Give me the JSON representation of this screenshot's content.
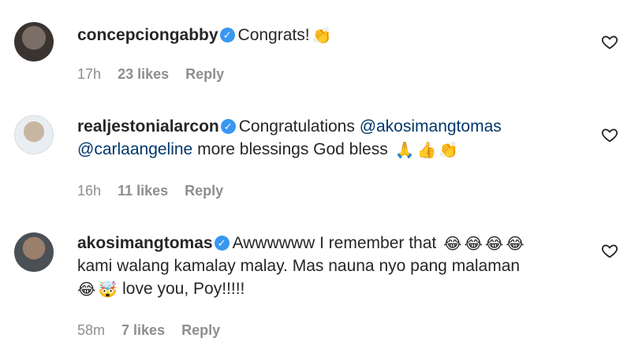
{
  "comments": [
    {
      "username": "concepciongabby",
      "text": "Congrats!",
      "text_emojis": [
        "👏"
      ],
      "time": "17h",
      "likes": "23 likes",
      "reply": "Reply"
    },
    {
      "username": "realjestonialarcon",
      "text_prefix": "Congratulations",
      "mention1": "@akosimangtomas",
      "mention2": "@carlaangeline",
      "text_suffix": "more blessings God bless",
      "text_emojis": [
        "🙏",
        "👍",
        "👏"
      ],
      "time": "16h",
      "likes": "11 likes",
      "reply": "Reply"
    },
    {
      "username": "akosimangtomas",
      "line1": "Awwwwww I remember that",
      "line1_emojis": [
        "😂",
        "😂",
        "😂",
        "😂"
      ],
      "line2": "kami walang kamalay malay. Mas nauna nyo pang malaman",
      "line3_emojis": [
        "😂",
        "🤯"
      ],
      "line3": "love you, Poy!!!!!",
      "time": "58m",
      "likes": "7 likes",
      "reply": "Reply"
    }
  ],
  "icons": {
    "verified": "verified-badge-icon",
    "like": "heart-outline-icon"
  }
}
